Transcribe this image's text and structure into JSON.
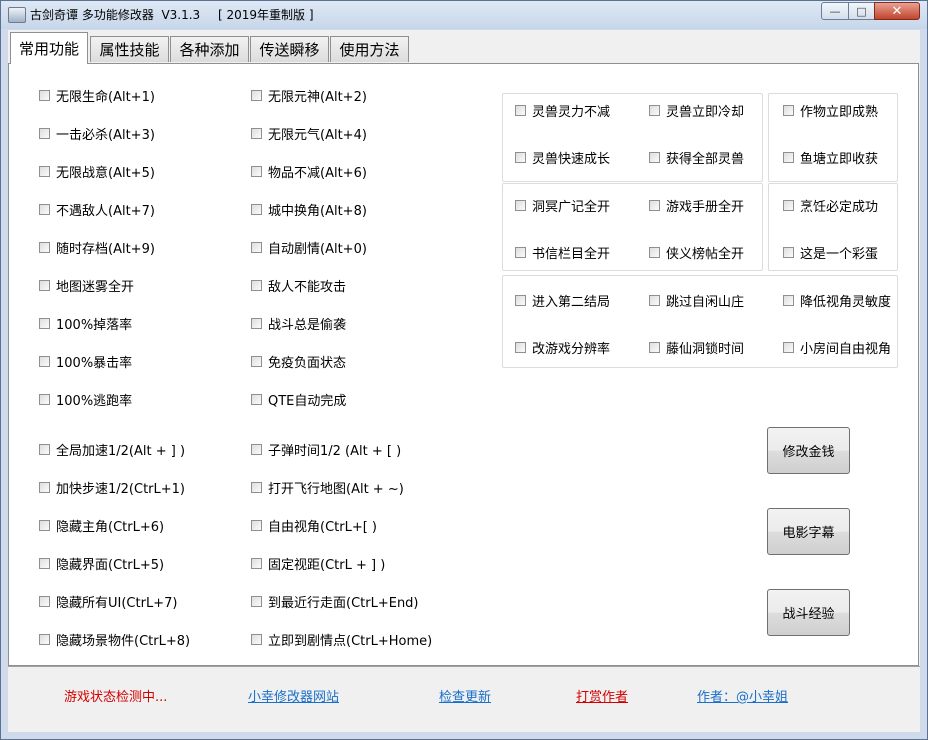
{
  "window": {
    "title": "古剑奇谭 多功能修改器  V3.1.3",
    "edition": "[ 2019年重制版 ]",
    "controls": {
      "minimize": "—",
      "maximize": "□",
      "close": "✕"
    }
  },
  "tabs": [
    "常用功能",
    "属性技能",
    "各种添加",
    "传送瞬移",
    "使用方法"
  ],
  "left_col1": [
    "无限生命(Alt+1)",
    "一击必杀(Alt+3)",
    "无限战意(Alt+5)",
    "不遇敌人(Alt+7)",
    "随时存档(Alt+9)",
    "地图迷雾全开",
    "100%掉落率",
    "100%暴击率",
    "100%逃跑率",
    "全局加速1/2(Alt + ] )",
    "加快步速1/2(CtrL+1)",
    "隐藏主角(CtrL+6)",
    "隐藏界面(CtrL+5)",
    "隐藏所有UI(CtrL+7)",
    "隐藏场景物件(CtrL+8)"
  ],
  "left_col2": [
    "无限元神(Alt+2)",
    "无限元气(Alt+4)",
    "物品不减(Alt+6)",
    "城中换角(Alt+8)",
    "自动剧情(Alt+0)",
    "敌人不能攻击",
    "战斗总是偷袭",
    "免疫负面状态",
    "QTE自动完成",
    "子弹时间1/2 (Alt + [ )",
    "打开飞行地图(Alt + ~)",
    "自由视角(CtrL+[ )",
    "固定视距(CtrL + ] )",
    "到最近行走面(CtrL+End)",
    "立即到剧情点(CtrL+Home)"
  ],
  "group_a": [
    "灵兽灵力不减",
    "灵兽立即冷却",
    "灵兽快速成长",
    "获得全部灵兽"
  ],
  "group_b": [
    "作物立即成熟",
    "鱼塘立即收获"
  ],
  "group_c": [
    "洞冥广记全开",
    "游戏手册全开",
    "书信栏目全开",
    "侠义榜帖全开"
  ],
  "group_d": [
    "烹饪必定成功",
    "这是一个彩蛋"
  ],
  "group_e": [
    "进入第二结局",
    "跳过自闲山庄",
    "降低视角灵敏度",
    "改游戏分辨率",
    "藤仙洞锁时间",
    "小房间自由视角"
  ],
  "buttons": [
    "修改金钱",
    "电影字幕",
    "战斗经验"
  ],
  "footer": {
    "status": "游戏状态检测中...",
    "site": "小幸修改器网站",
    "update": "检查更新",
    "donate": "打赏作者",
    "author": "作者：@小幸姐"
  },
  "colors": {
    "status": "#d40000",
    "link": "#1a6fc9",
    "donate": "#d40000"
  }
}
